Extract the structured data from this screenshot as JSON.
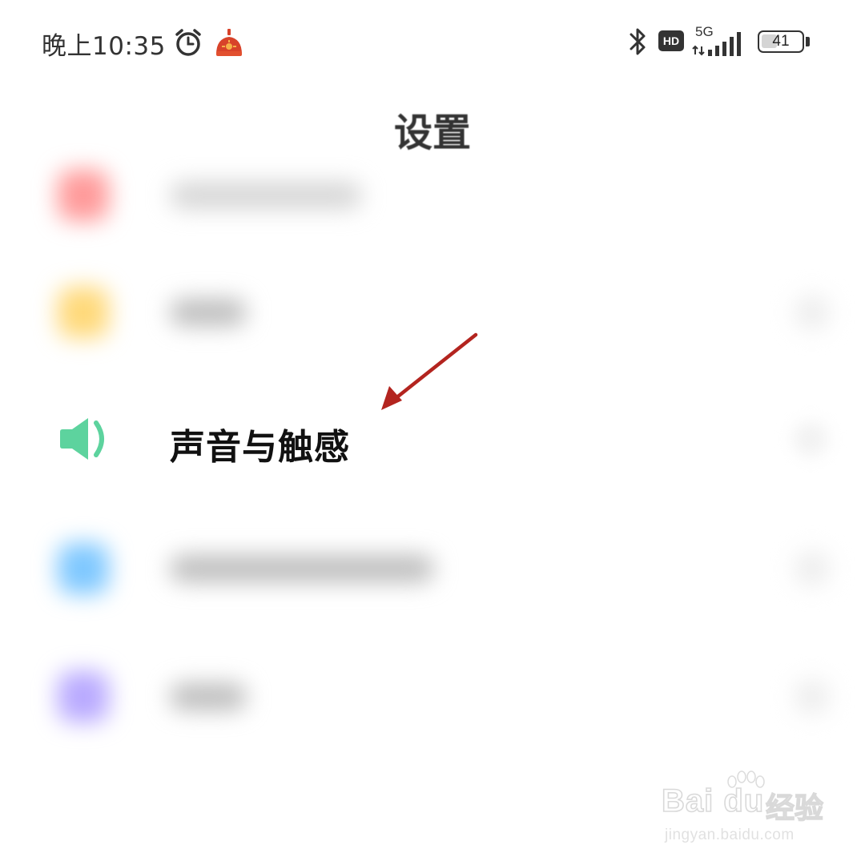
{
  "status_bar": {
    "time": "晚上10:35",
    "icons": [
      "alarm-clock-icon",
      "app-notification-icon",
      "bluetooth-icon",
      "hd-voice-icon",
      "signal-icon",
      "battery-icon"
    ],
    "hd_label": "HD",
    "network_type": "5G",
    "battery_level": "41",
    "battery_fraction": 0.41
  },
  "header": {
    "title": "设置"
  },
  "settings_list": {
    "focused_item": {
      "label": "声音与触感",
      "icon": "speaker-icon",
      "icon_color": "#5dd39e"
    },
    "blurred_item_colors": [
      "#ff9a9a",
      "#ffd97a",
      "#7fc8ff",
      "#b9aaff"
    ]
  },
  "annotation": {
    "type": "arrow",
    "color": "#b3241f",
    "points_to": "声音与触感"
  },
  "watermark": {
    "brand": "Bai du",
    "brand_cn": "经验",
    "url": "jingyan.baidu.com"
  }
}
